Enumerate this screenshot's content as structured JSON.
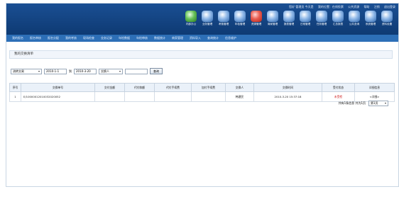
{
  "toplinks": [
    "您好 管理员 今天是",
    "我的位置：在线投票",
    "公共资源",
    "帮助",
    "注销",
    "退出登录"
  ],
  "toolbar": [
    {
      "label": "内部办公",
      "tone": "green"
    },
    {
      "label": "业务管理",
      "tone": "blue"
    },
    {
      "label": "考核管理",
      "tone": "blue"
    },
    {
      "label": "年检管理",
      "tone": "blue"
    },
    {
      "label": "资源管理",
      "tone": "red"
    },
    {
      "label": "商家管理",
      "tone": "blue"
    },
    {
      "label": "报表管理",
      "tone": "blue"
    },
    {
      "label": "日常管理",
      "tone": "blue"
    },
    {
      "label": "任务管理",
      "tone": "blue"
    },
    {
      "label": "汇总报表",
      "tone": "blue"
    },
    {
      "label": "公共查询",
      "tone": "blue"
    },
    {
      "label": "系统管理",
      "tone": "blue"
    },
    {
      "label": "资料设置",
      "tone": "blue"
    }
  ],
  "nav": [
    "我的报名",
    "报名审核",
    "报名分配",
    "我的考核",
    "现场检查",
    "业务记录",
    "年检数据",
    "年检审核",
    "数据统计",
    "商家管理",
    "资料导入",
    "查询统计",
    "信息维护"
  ],
  "page_title": "我的交换清单",
  "filters": {
    "type_select": "流转交易",
    "date_from": "2010-1-1",
    "date_to": "2010-3-20",
    "status_select": "交换人",
    "keyword": "",
    "to_label": "到",
    "search_button": "查询"
  },
  "table": {
    "headers": [
      "序号",
      "交换单号",
      "交付金额",
      "代付款额",
      "代付手续费",
      "加付手续费",
      "交换人",
      "交换时间",
      "受付状态",
      "详细信息"
    ],
    "rows": [
      [
        "1",
        "E/10000012010032020052",
        "",
        "",
        "",
        "",
        "韩建民",
        "2010-3-20 15:37:18",
        "未受检",
        "<详细>"
      ]
    ]
  },
  "pager": {
    "summary": "共有1条信息 共为1页",
    "select": "第1页"
  }
}
